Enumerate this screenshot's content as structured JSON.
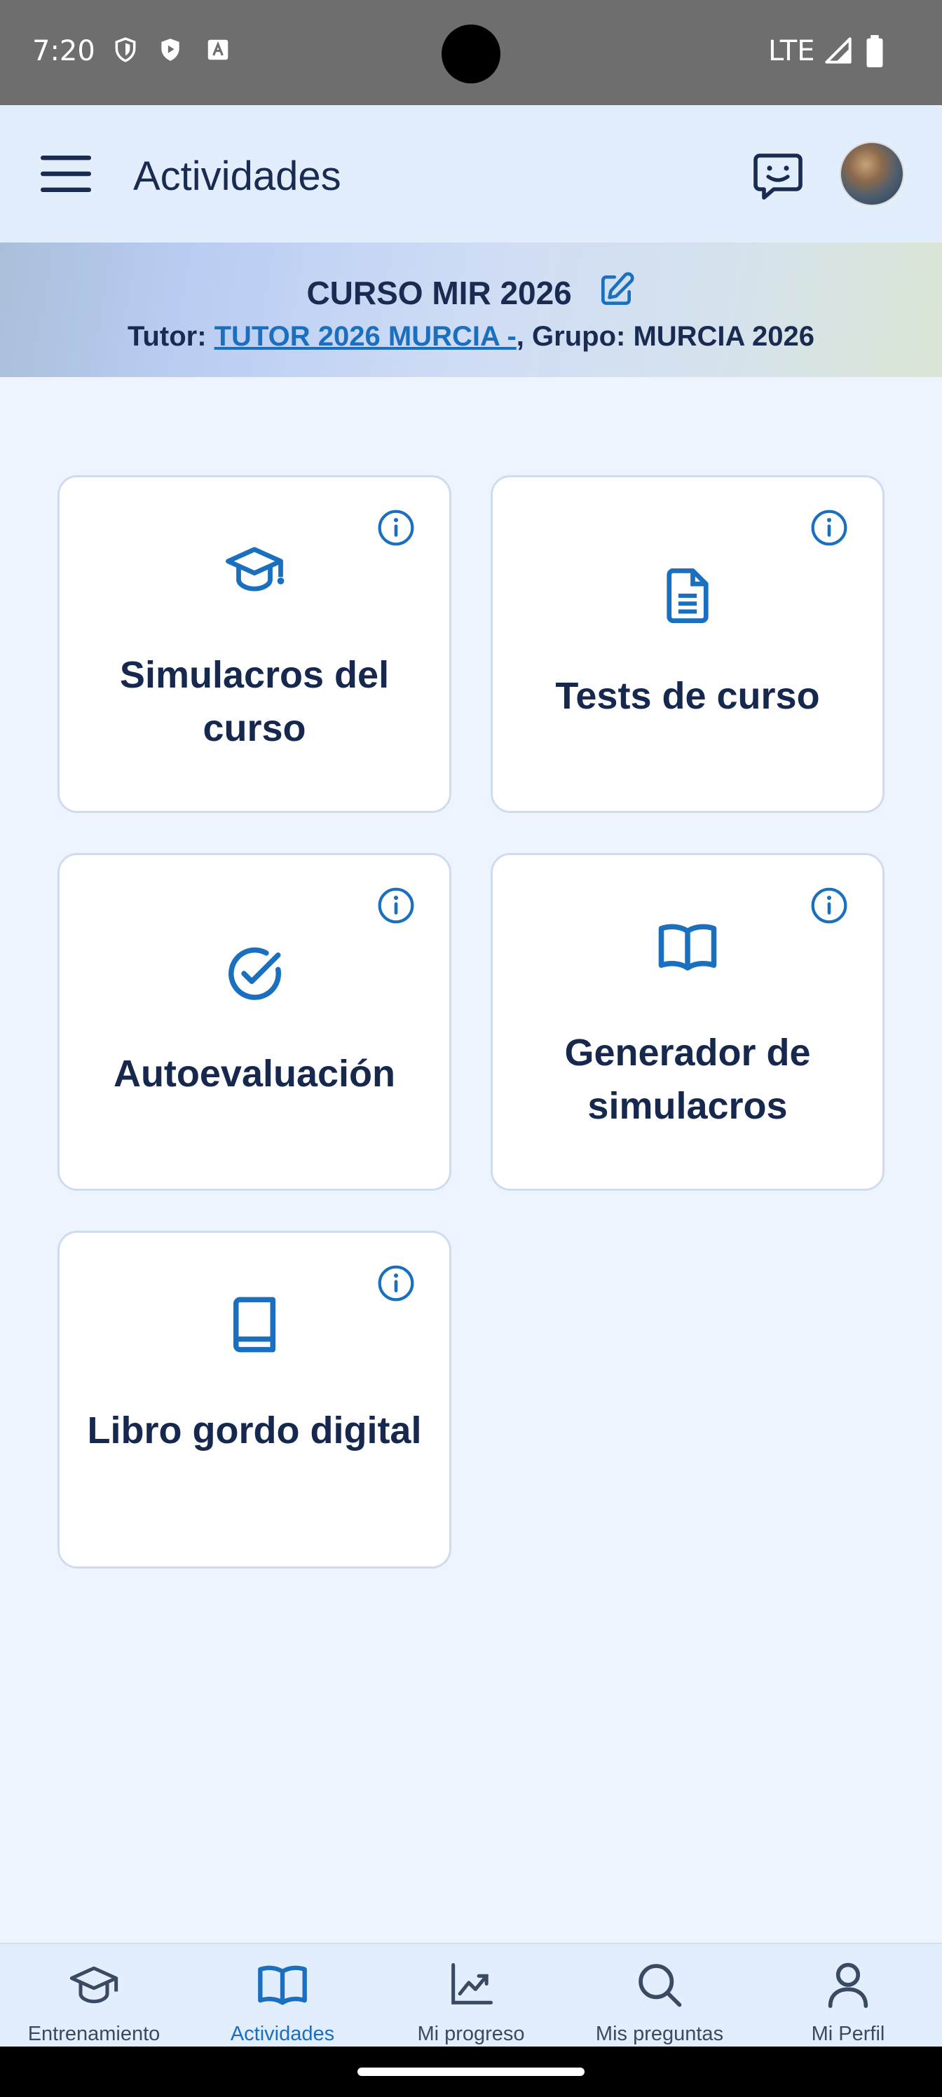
{
  "status_bar": {
    "time": "7:20",
    "network": "LTE",
    "icons": [
      "shield-icon",
      "play-protect-icon",
      "keyboard-a-icon",
      "signal-icon",
      "battery-icon"
    ]
  },
  "app_bar": {
    "title": "Actividades",
    "icons": [
      "menu-icon",
      "chat-icon",
      "avatar"
    ]
  },
  "banner": {
    "course": "CURSO MIR 2026",
    "tutor_label": "Tutor: ",
    "tutor_name": "TUTOR 2026 MURCIA -",
    "group_text": ", Grupo: MURCIA 2026"
  },
  "cards": [
    {
      "label": "Simulacros del curso",
      "icon": "graduation-cap-icon"
    },
    {
      "label": "Tests de curso",
      "icon": "document-icon"
    },
    {
      "label": "Autoevaluación",
      "icon": "check-circle-icon"
    },
    {
      "label": "Generador de simulacros",
      "icon": "open-book-icon"
    },
    {
      "label": "Libro gordo digital",
      "icon": "book-icon"
    }
  ],
  "bottom_nav": {
    "items": [
      {
        "label": "Entrenamiento",
        "icon": "graduation-cap-icon"
      },
      {
        "label": "Actividades",
        "icon": "open-book-icon",
        "active": true
      },
      {
        "label": "Mi progreso",
        "icon": "chart-icon"
      },
      {
        "label": "Mis preguntas",
        "icon": "search-icon"
      },
      {
        "label": "Mi Perfil",
        "icon": "user-icon"
      }
    ]
  },
  "colors": {
    "accent": "#1a6fbf",
    "text_dark": "#16284d",
    "background": "#eef4fd",
    "status_bar": "#6e6e6e"
  }
}
